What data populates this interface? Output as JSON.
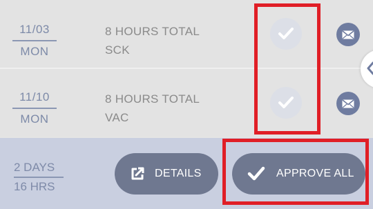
{
  "timesheet": {
    "rows": [
      {
        "date": "11/03",
        "weekday": "MON",
        "hours": "8 HOURS TOTAL",
        "code": "SCK",
        "approve_icon": "check-icon",
        "message_icon": "envelope-icon"
      },
      {
        "date": "11/10",
        "weekday": "MON",
        "hours": "8 HOURS TOTAL",
        "code": "VAC",
        "approve_icon": "check-icon",
        "message_icon": "envelope-icon"
      }
    ]
  },
  "footer": {
    "days": "2 DAYS",
    "hours": "16 HRS",
    "details_label": "DETAILS",
    "details_icon": "external-link-icon",
    "approve_all_label": "APPROVE ALL",
    "approve_all_icon": "check-icon"
  },
  "side_panel": {
    "toggle_icon": "chevron-left-icon"
  },
  "colors": {
    "row_bg": "#e3e3e3",
    "footer_bg": "#c9cfe0",
    "accent": "#6f7ca0",
    "button_bg": "#6f7890",
    "highlight": "#e01e26"
  }
}
